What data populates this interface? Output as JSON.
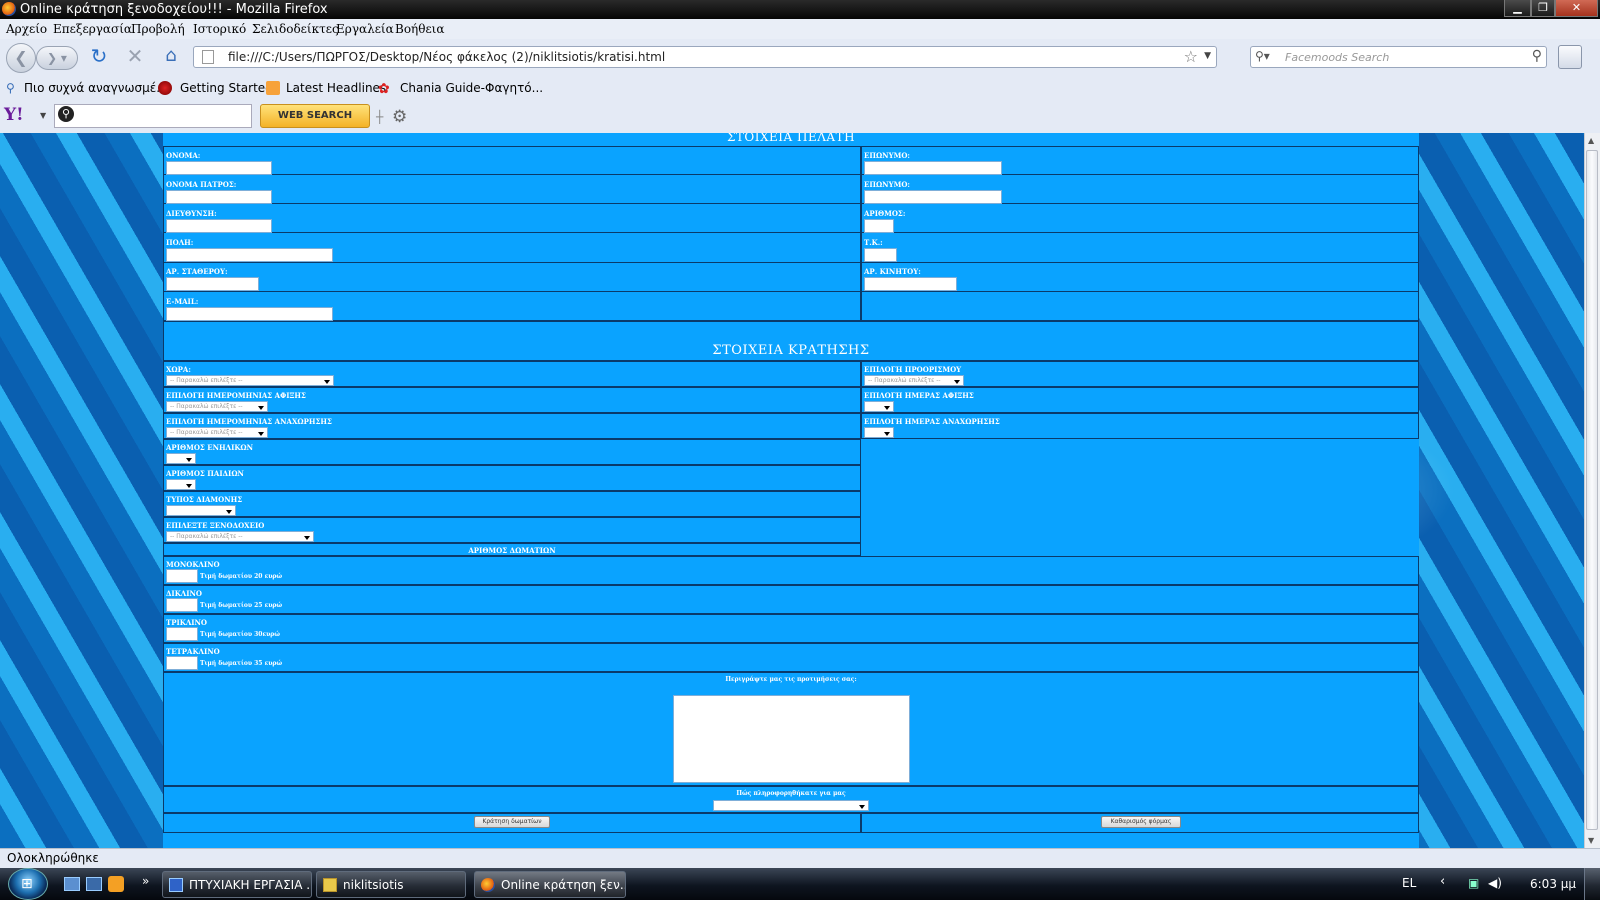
{
  "window": {
    "title": "Online κράτηση ξενοδοχείου!!! - Mozilla Firefox",
    "min": "▁",
    "max": "❐",
    "close": "✕"
  },
  "menu": [
    "Αρχείο",
    "Επεξεργασία",
    "Προβολή",
    "Ιστορικό",
    "Σελιδοδείκτες",
    "Εργαλεία",
    "Βοήθεια"
  ],
  "nav": {
    "url": "file:///C:/Users/ΠΩΡΓΟΣ/Desktop/Νέος φάκελος (2)/niklitsiotis/kratisi.html",
    "search_placeholder": "Facemoods Search"
  },
  "bookmarks": [
    "Πιο συχνά αναγνωσμέ...",
    "Getting Started",
    "Latest Headlines",
    "Chania Guide-Φαγητό..."
  ],
  "yahoo": {
    "logo": "Y!",
    "search_button": "WEB SEARCH"
  },
  "form": {
    "section_customer": "ΣΤΟΙΧΕΙΑ ΠΕΛΑΤΗ",
    "name": "ΟΝΟΜΑ:",
    "surname1": "ΕΠΩΝΥΜΟ:",
    "father": "ΟΝΟΜΑ ΠΑΤΡΟΣ:",
    "surname2": "ΕΠΩΝΥΜΟ:",
    "address": "ΔΙΕΥΘΥΝΣΗ:",
    "number": "ΑΡΙΘΜΟΣ:",
    "city": "ΠΟΛΗ:",
    "zip": "Τ.Κ.:",
    "phone": "ΑΡ. ΣΤΑΘΕΡΟΥ:",
    "mobile": "ΑΡ. ΚΙΝΗΤΟΥ:",
    "email": "E-MAIL:",
    "section_booking": "ΣΤΟΙΧΕΙΑ ΚΡΑΤΗΣΗΣ",
    "country": "ΧΩΡΑ:",
    "destination": "ΕΠΙΛΟΓΗ ΠΡΟΟΡΙΣΜΟΥ",
    "arrival_date": "ΕΠΙΛΟΓΗ ΗΜΕΡΟΜΗΝΙΑΣ ΑΦΙΞΗΣ",
    "arrival_day": "ΕΠΙΛΟΓΗ ΗΜΕΡΑΣ ΑΦΙΞΗΣ",
    "departure_date": "ΕΠΙΛΟΓΗ ΗΜΕΡΟΜΗΝΙΑΣ ΑΝΑΧΩΡΗΣΗΣ",
    "departure_day": "ΕΠΙΛΟΓΗ ΗΜΕΡΑΣ ΑΝΑΧΩΡΗΣΗΣ",
    "adults": "ΑΡΙΘΜΟΣ ΕΝΗΛΙΚΩΝ",
    "children": "ΑΡΙΘΜΟΣ ΠΑΙΔΙΩΝ",
    "stay_type": "ΤΥΠΟΣ ΔΙΑΜΟΝΗΣ",
    "hotel": "ΕΠΙΛΕΞΤΕ ΞΕΝΟΔΟΧΕΙΟ",
    "rooms_count": "ΑΡΙΘΜΟΣ ΔΩΜΑΤΙΩΝ",
    "select_placeholder": "-- Παρακαλώ επιλέξτε --",
    "single": "ΜΟΝΟΚΛΙΝΟ",
    "single_price": "Τιμή δωματίου 20 ευρώ",
    "double": "ΔΙΚΛΙΝΟ",
    "double_price": "Τιμή δωματίου 25 ευρώ",
    "triple": "ΤΡΙΚΛΙΝΟ",
    "triple_price": "Τιμή δωματίου 30ευρώ",
    "quad": "ΤΕΤΡΑΚΛΙΝΟ",
    "quad_price": "Τιμή δωματίου 35 ευρώ",
    "preferences": "Περιγράψτε μας τις προτιμήσεις σας:",
    "heard_from": "Πώς πληροφορηθήκατε για μας",
    "submit": "Κράτηση δωματίων",
    "reset": "Καθαρισμός φόρμας"
  },
  "status": "Ολοκληρώθηκε",
  "taskbar": {
    "tasks": [
      "ΠΤΥΧΙΑΚΗ ΕΡΓΑΣΙΑ ...",
      "niklitsiotis",
      "Online κράτηση ξεν..."
    ],
    "lang": "EL",
    "time": "6:03 μμ"
  }
}
